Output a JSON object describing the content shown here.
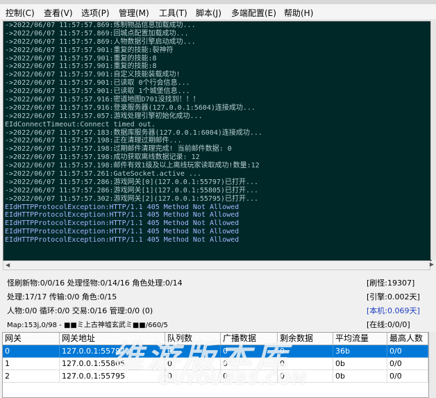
{
  "menu": [
    {
      "label": "控制(C)"
    },
    {
      "label": "查看(V)"
    },
    {
      "label": "选项(P)"
    },
    {
      "label": "管理(M)"
    },
    {
      "label": "工具(T)"
    },
    {
      "label": "脚本(J)"
    },
    {
      "label": "多端配置(E)"
    },
    {
      "label": "帮助(H)"
    }
  ],
  "console": {
    "lines": [
      {
        "text": "->2022/06/07 11:57:57.869:炼制物品信息加载成功...",
        "type": "info"
      },
      {
        "text": "->2022/06/07 11:57:57.869:回城点配置加载成功...",
        "type": "info"
      },
      {
        "text": "->2022/06/07 11:57:57.869:人物数据引擎启动成功...",
        "type": "info"
      },
      {
        "text": "->2022/06/07 11:57:57.901:重复的技能:裂神符",
        "type": "info"
      },
      {
        "text": "->2022/06/07 11:57:57.901:重复的技能:8",
        "type": "info"
      },
      {
        "text": "->2022/06/07 11:57:57.901:重复的技能:8",
        "type": "info"
      },
      {
        "text": "->2022/06/07 11:57:57.901:自定义技能装载成功!",
        "type": "info"
      },
      {
        "text": "->2022/06/07 11:57:57.901:已读取 0个行会信息...",
        "type": "info"
      },
      {
        "text": "->2022/06/07 11:57:57.901:已读取 1个城堡信息...",
        "type": "info"
      },
      {
        "text": "->2022/06/07 11:57:57.916:密道地图D701没找到！！！",
        "type": "info"
      },
      {
        "text": "->2022/06/07 11:57:57.916:登录服务器(127.0.0.1:5604)连接成功...",
        "type": "info"
      },
      {
        "text": "->2022/06/07 11:57:57.057:游戏处理引擎初始化成功...",
        "type": "info"
      },
      {
        "text": "EIdConnectTimeout:Connect timed out.",
        "type": "info"
      },
      {
        "text": "->2022/06/07 11:57:57.183:数据库服务器(127.0.0.1:6004)连接成功...",
        "type": "info"
      },
      {
        "text": "->2022/06/07 11:57:57.198:正在清理过期邮件...",
        "type": "info"
      },
      {
        "text": "->2022/06/07 11:57:57.198:过期邮件清理完成! 当前邮件数据: 0",
        "type": "info"
      },
      {
        "text": "->2022/06/07 11:57:57.198:成功获取离线数据记录: 12",
        "type": "info"
      },
      {
        "text": "->2022/06/07 11:57:57.198:邮件有效1级及以上离线玩家读取成功!数量:12",
        "type": "info"
      },
      {
        "text": "->2022/06/07 11:57:57.261:GateSocket.active ...",
        "type": "info"
      },
      {
        "text": "->2022/06/07 11:57:57.286:游戏网关[0](127.0.0.1:55797)已打开...",
        "type": "info"
      },
      {
        "text": "->2022/06/07 11:57:57.286:游戏网关[1](127.0.0.1:55805)已打开...",
        "type": "info"
      },
      {
        "text": "->2022/06/07 11:57:57.302:游戏网关[2](127.0.0.1:55795)已打开...",
        "type": "info"
      },
      {
        "text": "EIdHTTPProtocolException:HTTP/1.1 405 Method Not Allowed",
        "type": "err"
      },
      {
        "text": "EIdHTTPProtocolException:HTTP/1.1 405 Method Not Allowed",
        "type": "err"
      },
      {
        "text": "EIdHTTPProtocolException:HTTP/1.1 405 Method Not Allowed",
        "type": "err"
      },
      {
        "text": "EIdHTTPProtocolException:HTTP/1.1 405 Method Not Allowed",
        "type": "err"
      },
      {
        "text": "EIdHTTPProtocolException:HTTP/1.1 405 Method Not Allowed",
        "type": "err"
      }
    ]
  },
  "stats": {
    "line1": "怪刷新物:0/0/16 处理怪物:0/14/16 角色处理:0/14",
    "line2": "处理:17/17 传输:0/0 角色:0/15",
    "line3": "人物:0/0 循环:0/0 交易:0/16 管理:0/0 (0)",
    "line4": "Map:153j,0/98 - ■■ミ上古神墟玄武ミ■■/660/5",
    "refresh": "[刷怪:19307]",
    "engine": "[引擎:0.002天]",
    "local": "[本机:0.069天]",
    "online": "[在线:0/0/0]"
  },
  "colors": {
    "accent": "#0078d7",
    "local_stat": "#1f3fbf",
    "console_bg": "#002828",
    "console_text": "#b5ccd0",
    "console_err": "#a7b7ff"
  },
  "gate_table": {
    "headers": [
      "网关",
      "网关地址",
      "队列数",
      "广播数据",
      "剩余数据",
      "平均流量",
      "最高人数"
    ],
    "rows": [
      [
        "0",
        "127.0.0.1:55797",
        "0",
        "0",
        "0",
        "36b",
        "0/0"
      ],
      [
        "1",
        "127.0.0.1:55805",
        "0",
        "0",
        "0",
        "0b",
        "0/0"
      ],
      [
        "2",
        "127.0.0.1:55795",
        "0",
        "0",
        "0",
        "0b",
        "0/0"
      ]
    ],
    "selected_row": 0
  },
  "watermark": {
    "main": "维游版本库",
    "sub": "OUYOUBBS.COM"
  }
}
